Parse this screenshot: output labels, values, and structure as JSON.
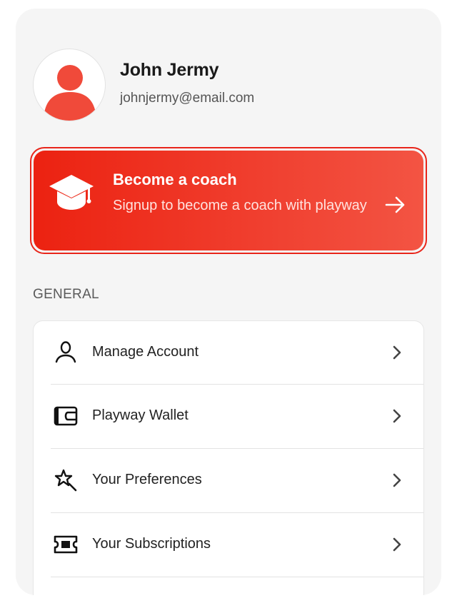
{
  "profile": {
    "name": "John Jermy",
    "email": "johnjermy@email.com"
  },
  "coach_banner": {
    "title": "Become a coach",
    "subtitle": "Signup to become a coach with playway",
    "icon": "graduation-cap-icon",
    "action_icon": "arrow-right-icon"
  },
  "general": {
    "section_label": "GENERAL",
    "items": [
      {
        "label": "Manage Account",
        "icon": "user-icon"
      },
      {
        "label": "Playway Wallet",
        "icon": "wallet-icon"
      },
      {
        "label": "Your Preferences",
        "icon": "magic-wand-icon"
      },
      {
        "label": "Your Subscriptions",
        "icon": "ticket-icon"
      }
    ]
  },
  "colors": {
    "accent": "#ec2211",
    "background": "#f5f5f5",
    "card": "#ffffff"
  }
}
